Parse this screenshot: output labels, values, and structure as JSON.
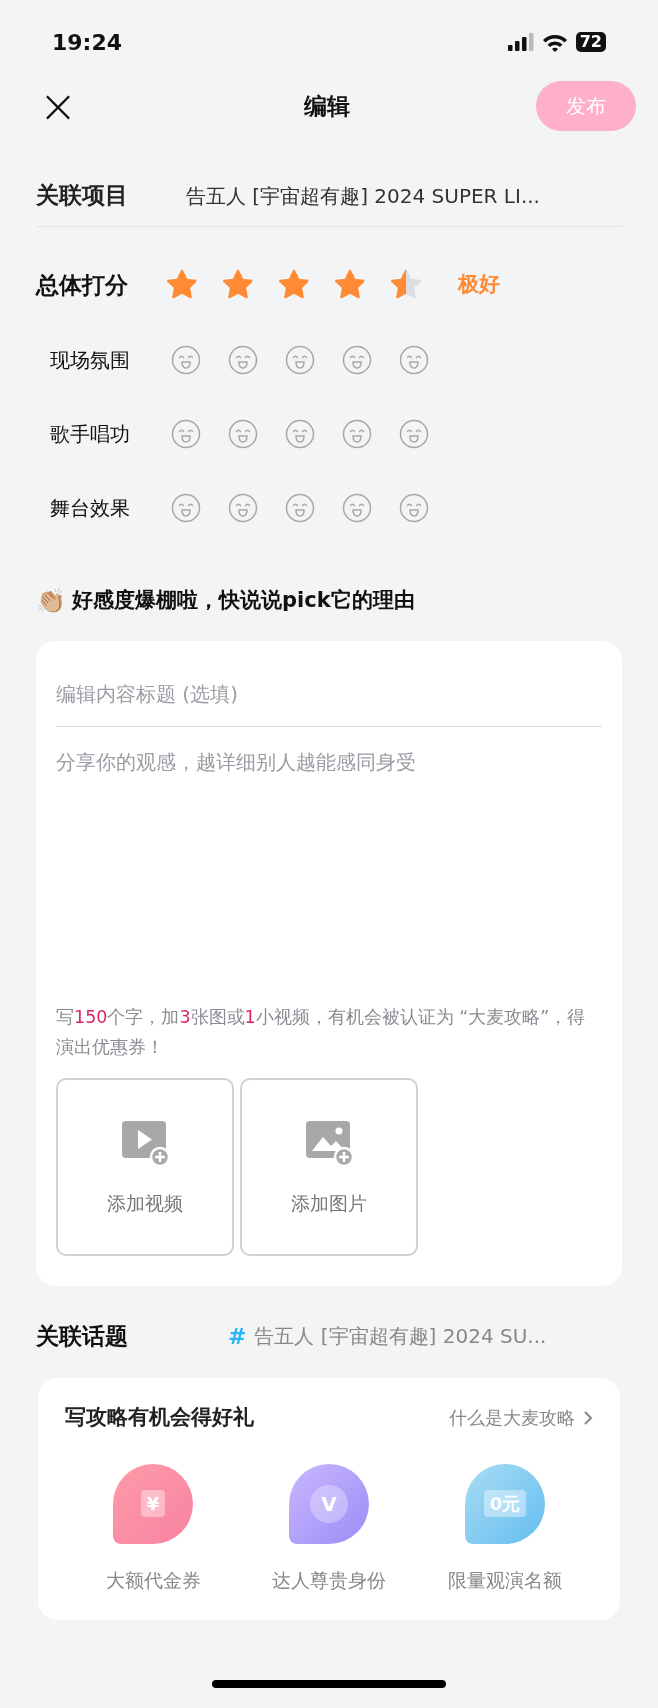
{
  "status_bar": {
    "time": "19:24",
    "battery": "72"
  },
  "header": {
    "close": "×",
    "title": "编辑",
    "publish_button": "发布"
  },
  "project": {
    "label": "关联项目",
    "value": "告五人 [宇宙超有趣] 2024 SUPER LI..."
  },
  "overall": {
    "label": "总体打分",
    "stars": 4.5,
    "verdict": "极好"
  },
  "sub_ratings": [
    {
      "label": "现场氛围",
      "stars": 0
    },
    {
      "label": "歌手唱功",
      "stars": 0
    },
    {
      "label": "舞台效果",
      "stars": 0
    }
  ],
  "prompt": {
    "emoji": "👏🏼",
    "text": "好感度爆棚啦，快说说pick它的理由"
  },
  "editor": {
    "title_placeholder": "编辑内容标题 (选填)",
    "body_placeholder": "分享你的观感，越详细别人越能感同身受",
    "tip": [
      {
        "text": "写",
        "highlight": false
      },
      {
        "text": "150",
        "highlight": true
      },
      {
        "text": "个字，加",
        "highlight": false
      },
      {
        "text": "3",
        "highlight": true
      },
      {
        "text": "张图或",
        "highlight": false
      },
      {
        "text": "1",
        "highlight": true
      },
      {
        "text": "小视频，有机会被认证为 “大麦攻略”，得演出优惠券！",
        "highlight": false
      }
    ],
    "uploads": [
      {
        "kind": "video",
        "label": "添加视频"
      },
      {
        "kind": "image",
        "label": "添加图片"
      }
    ]
  },
  "topic": {
    "label": "关联话题",
    "hash": "#",
    "value": "告五人 [宇宙超有趣] 2024 SU..."
  },
  "rewards": {
    "title": "写攻略有机会得好礼",
    "link": "什么是大麦攻略",
    "items": [
      {
        "kind": "voucher",
        "icon_text": "¥",
        "label": "大额代金券"
      },
      {
        "kind": "vip",
        "icon_text": "V",
        "label": "达人尊贵身份"
      },
      {
        "kind": "ticket",
        "icon_text": "0元",
        "label": "限量观演名额"
      }
    ]
  }
}
